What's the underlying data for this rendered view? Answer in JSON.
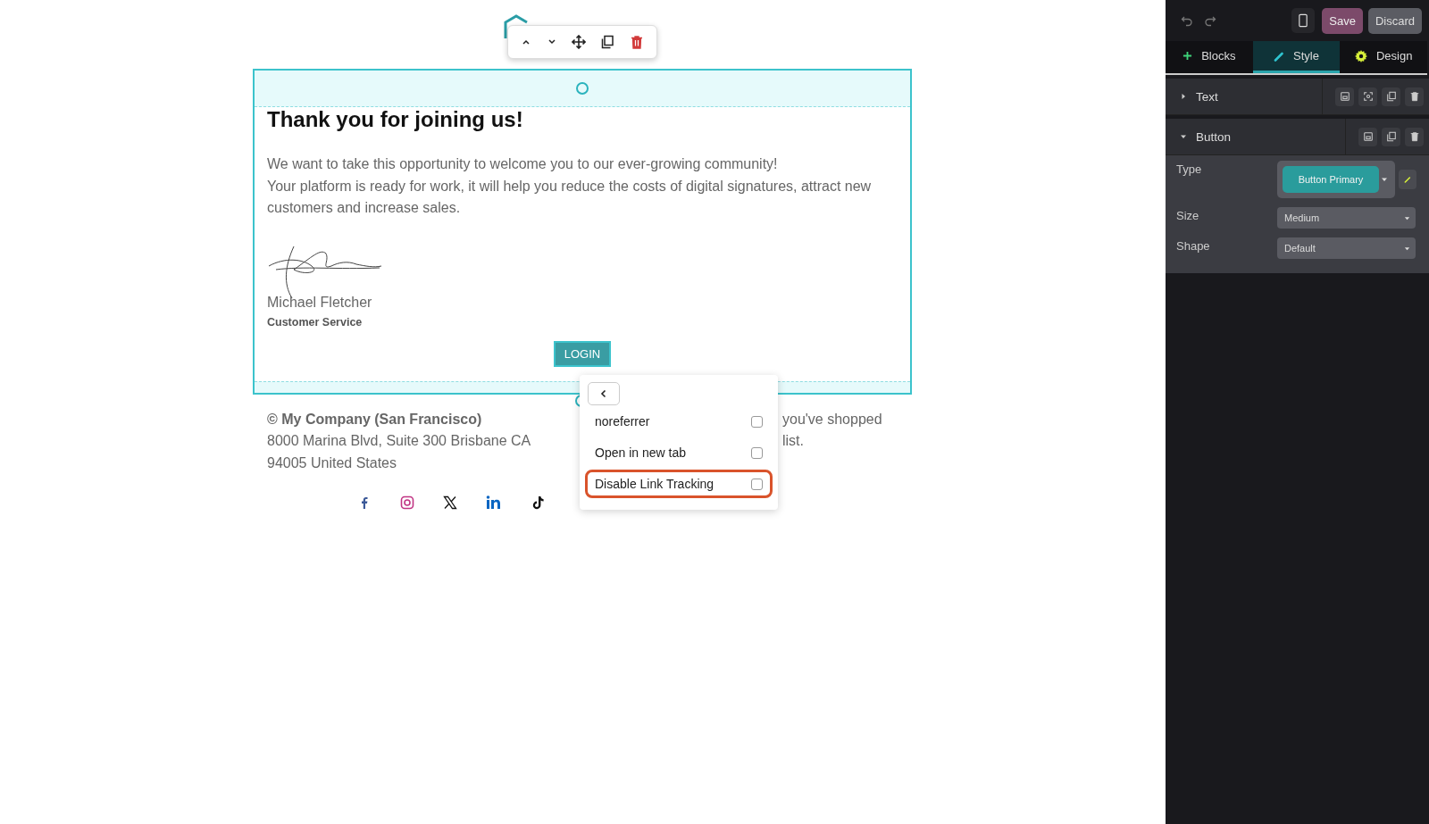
{
  "email": {
    "title": "Thank you for joining us!",
    "paragraphs": [
      "We want to take this opportunity to welcome you to our ever-growing community!",
      "Your platform is ready for work, it will help you reduce the costs of digital signatures, attract new customers and increase sales."
    ],
    "signer_name": "Michael Fletcher",
    "signer_role": "Customer Service",
    "button": "LOGIN"
  },
  "footer": {
    "company": "© My Company (San Francisco)",
    "address_lines": [
      "8000 Marina Blvd, Suite 300 Brisbane CA",
      "94005 United States"
    ],
    "note_fragments": [
      "you've shopped",
      "list."
    ]
  },
  "link_options": [
    {
      "label": "noreferrer",
      "checked": false,
      "highlighted": false
    },
    {
      "label": "Open in new tab",
      "checked": false,
      "highlighted": false
    },
    {
      "label": "Disable Link Tracking",
      "checked": false,
      "highlighted": true
    }
  ],
  "panel": {
    "save": "Save",
    "discard": "Discard",
    "tabs": [
      {
        "label": "Blocks",
        "kind": "plus",
        "selected": false
      },
      {
        "label": "Style",
        "kind": "pencil",
        "selected": true
      },
      {
        "label": "Design",
        "kind": "gear",
        "selected": false
      }
    ],
    "sections": [
      {
        "title": "Text",
        "expanded": false
      },
      {
        "title": "Button",
        "expanded": true,
        "fields": [
          {
            "label": "Type",
            "kind": "preset",
            "value": "Button Primary"
          },
          {
            "label": "Size",
            "kind": "select",
            "value": "Medium"
          },
          {
            "label": "Shape",
            "kind": "select",
            "value": "Default"
          }
        ]
      }
    ]
  }
}
